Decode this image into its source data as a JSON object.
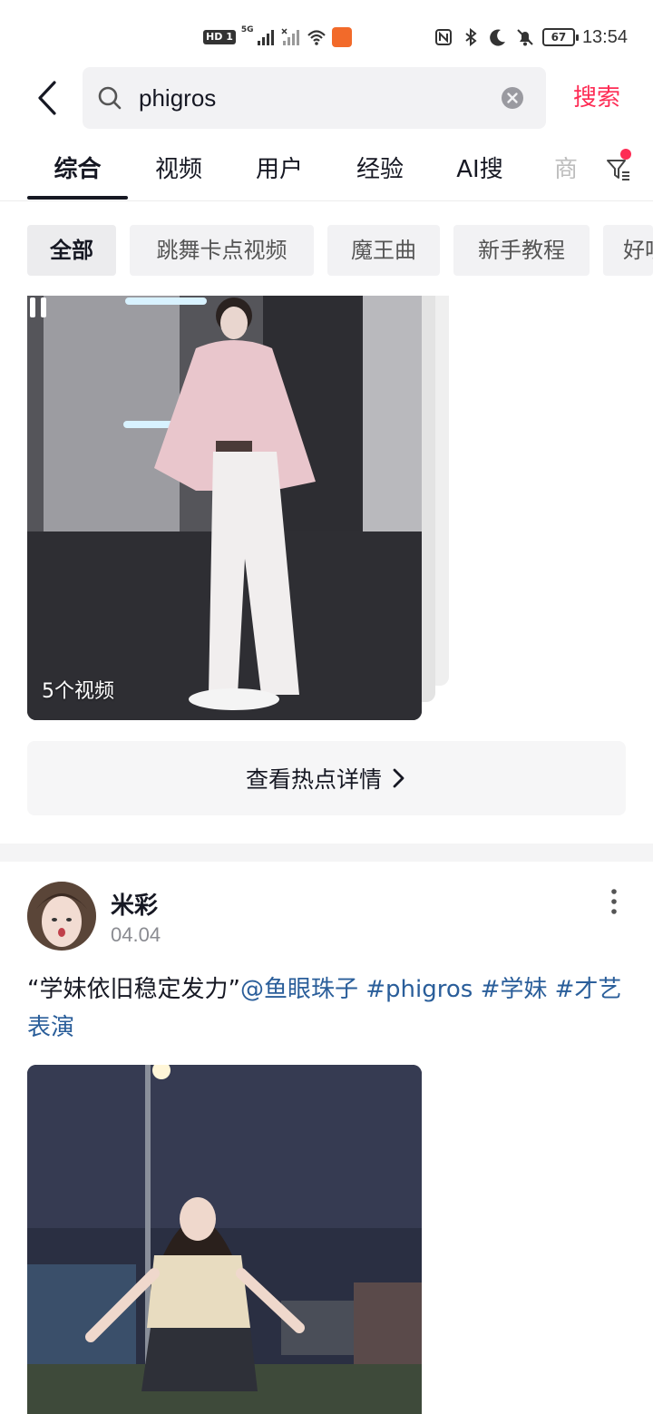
{
  "status_bar": {
    "hd_label": "HD",
    "sim_label": "1",
    "network_label": "5G",
    "battery_level": "67",
    "time": "13:54"
  },
  "search": {
    "query": "phigros",
    "submit_label": "搜索"
  },
  "tabs": [
    {
      "label": "综合",
      "active": true
    },
    {
      "label": "视频",
      "active": false
    },
    {
      "label": "用户",
      "active": false
    },
    {
      "label": "经验",
      "active": false
    },
    {
      "label": "AI搜",
      "active": false
    },
    {
      "label": "商",
      "active": false
    }
  ],
  "chips": [
    {
      "label": "全部",
      "active": true
    },
    {
      "label": "跳舞卡点视频",
      "active": false
    },
    {
      "label": "魔王曲",
      "active": false
    },
    {
      "label": "新手教程",
      "active": false
    },
    {
      "label": "好听",
      "active": false
    }
  ],
  "hot_card": {
    "video_count": "5个视频",
    "detail_label": "查看热点详情"
  },
  "post": {
    "author": "米彩",
    "date": "04.04",
    "caption_text": "“学妹依旧稳定发力”",
    "mention": "@鱼眼珠子",
    "tags": [
      "#phigros",
      "#学妹",
      "#才艺表演"
    ]
  },
  "colors": {
    "accent": "#fe2c55",
    "link": "#2a5e9a",
    "chip_bg": "#f2f2f4"
  }
}
